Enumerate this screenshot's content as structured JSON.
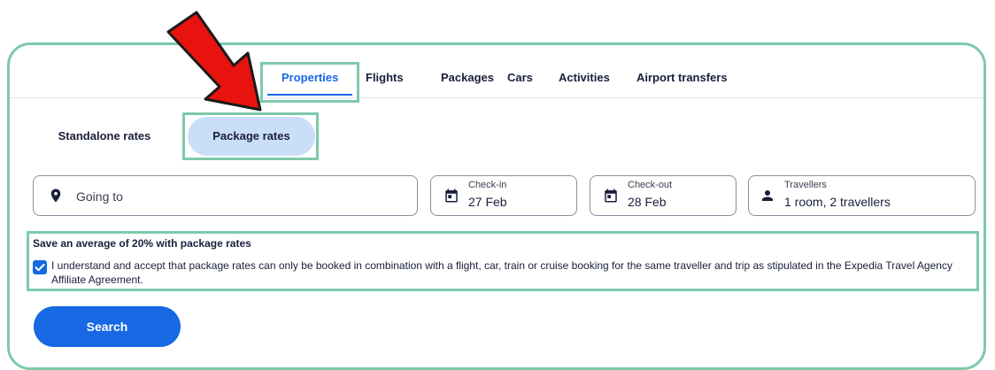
{
  "tabs": [
    {
      "label": "Properties",
      "active": true
    },
    {
      "label": "Flights"
    },
    {
      "label": "Packages"
    },
    {
      "label": "Cars"
    },
    {
      "label": "Activities"
    },
    {
      "label": "Airport transfers"
    }
  ],
  "rate_toggle": {
    "standalone_label": "Standalone rates",
    "package_label": "Package rates",
    "selected": "Package rates"
  },
  "search_fields": {
    "destination_placeholder": "Going to",
    "checkin": {
      "label": "Check-in",
      "value": "27 Feb"
    },
    "checkout": {
      "label": "Check-out",
      "value": "28 Feb"
    },
    "travellers": {
      "label": "Travellers",
      "value": "1 room, 2 travellers"
    }
  },
  "notice": {
    "title": "Save an average of 20% with package rates",
    "checkbox_checked": true,
    "text": "I understand and accept that package rates can only be booked in combination with a flight, car, train or cruise booking for the same traveller and trip as stipulated in the Expedia Travel Agency Affiliate Agreement."
  },
  "search_button_label": "Search",
  "colors": {
    "accent": "#1668e3",
    "highlight_border": "#7ec9aa",
    "selected_pill": "#c9dff8",
    "annotation_arrow": "#e8130e"
  },
  "icons": [
    "location-pin-icon",
    "calendar-icon",
    "calendar-icon",
    "person-icon",
    "checkmark-icon",
    "red-arrow-annotation"
  ]
}
